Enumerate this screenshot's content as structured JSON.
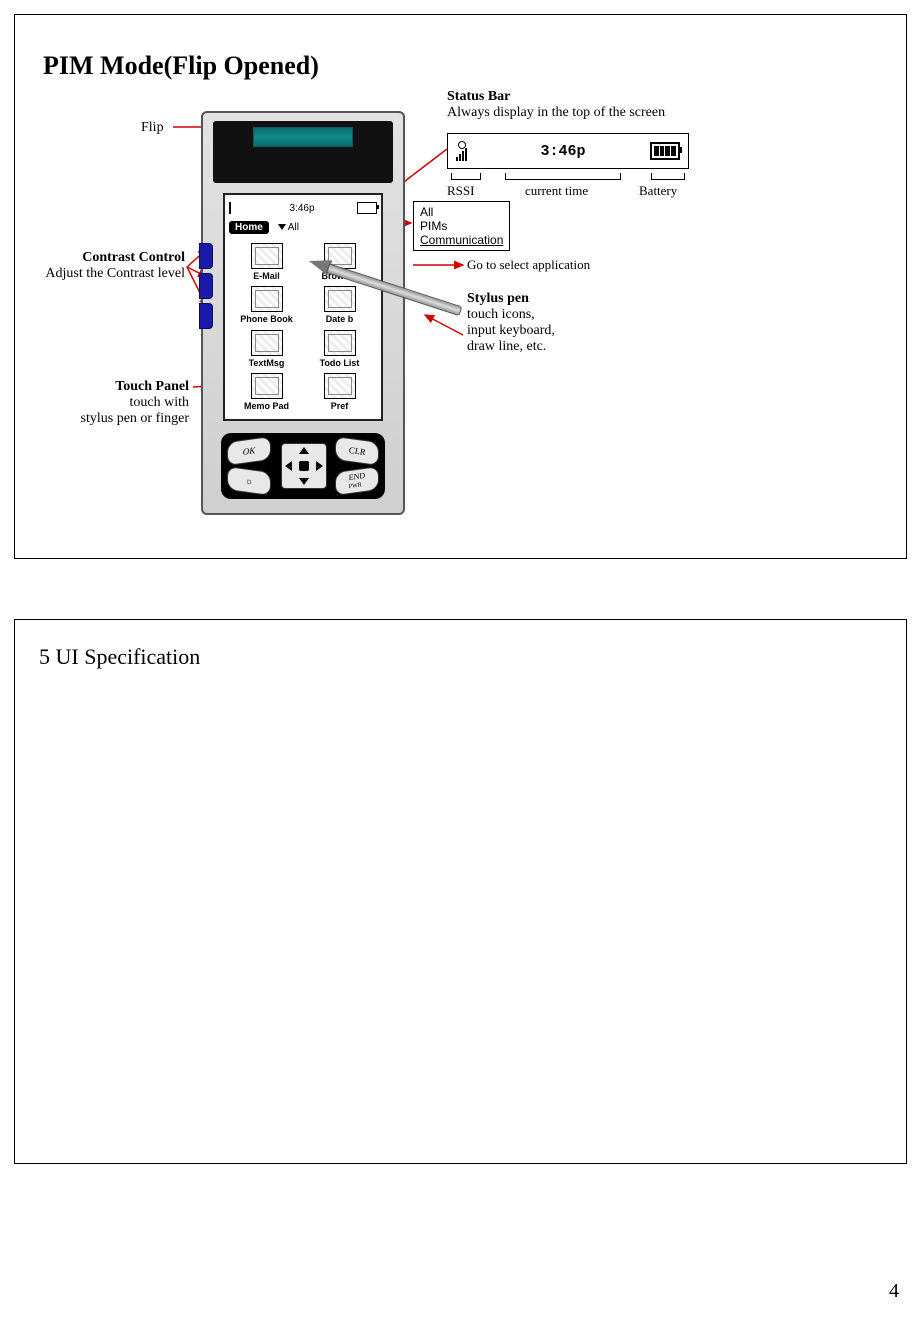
{
  "page_number": "4",
  "slide1": {
    "title": "PIM Mode(Flip Opened)",
    "statusbar": {
      "heading": "Status Bar",
      "desc": "Always display in the top of the screen",
      "time": "3:46p",
      "rssi_label": "RSSI",
      "time_label": "current time",
      "battery_label": "Battery"
    },
    "flip_label": "Flip",
    "contrast": {
      "title": "Contrast Control",
      "desc": "Adjust the Contrast level"
    },
    "touch": {
      "title": "Touch Panel",
      "line1": "touch with",
      "line2": "stylus pen or finger"
    },
    "stylus": {
      "title": "Stylus pen",
      "l1": "touch icons,",
      "l2": "input keyboard,",
      "l3": "draw line, etc."
    },
    "dropdown": {
      "opt1": "All",
      "opt2": "PIMs",
      "opt3": "Communication"
    },
    "goto_label": "Go to select application",
    "device": {
      "mini_time": "3:46p",
      "home": "Home",
      "all": "All",
      "apps": [
        "E-Mail",
        "Browser",
        "Phone Book",
        "Date b",
        "TextMsg",
        "Todo List",
        "Memo Pad",
        "Pref"
      ],
      "keys": {
        "ok": "OK",
        "clr": "CLR",
        "end": "END",
        "pwr": "PWR",
        "light": "light"
      }
    }
  },
  "slide2": {
    "title": "5 UI Specification"
  }
}
